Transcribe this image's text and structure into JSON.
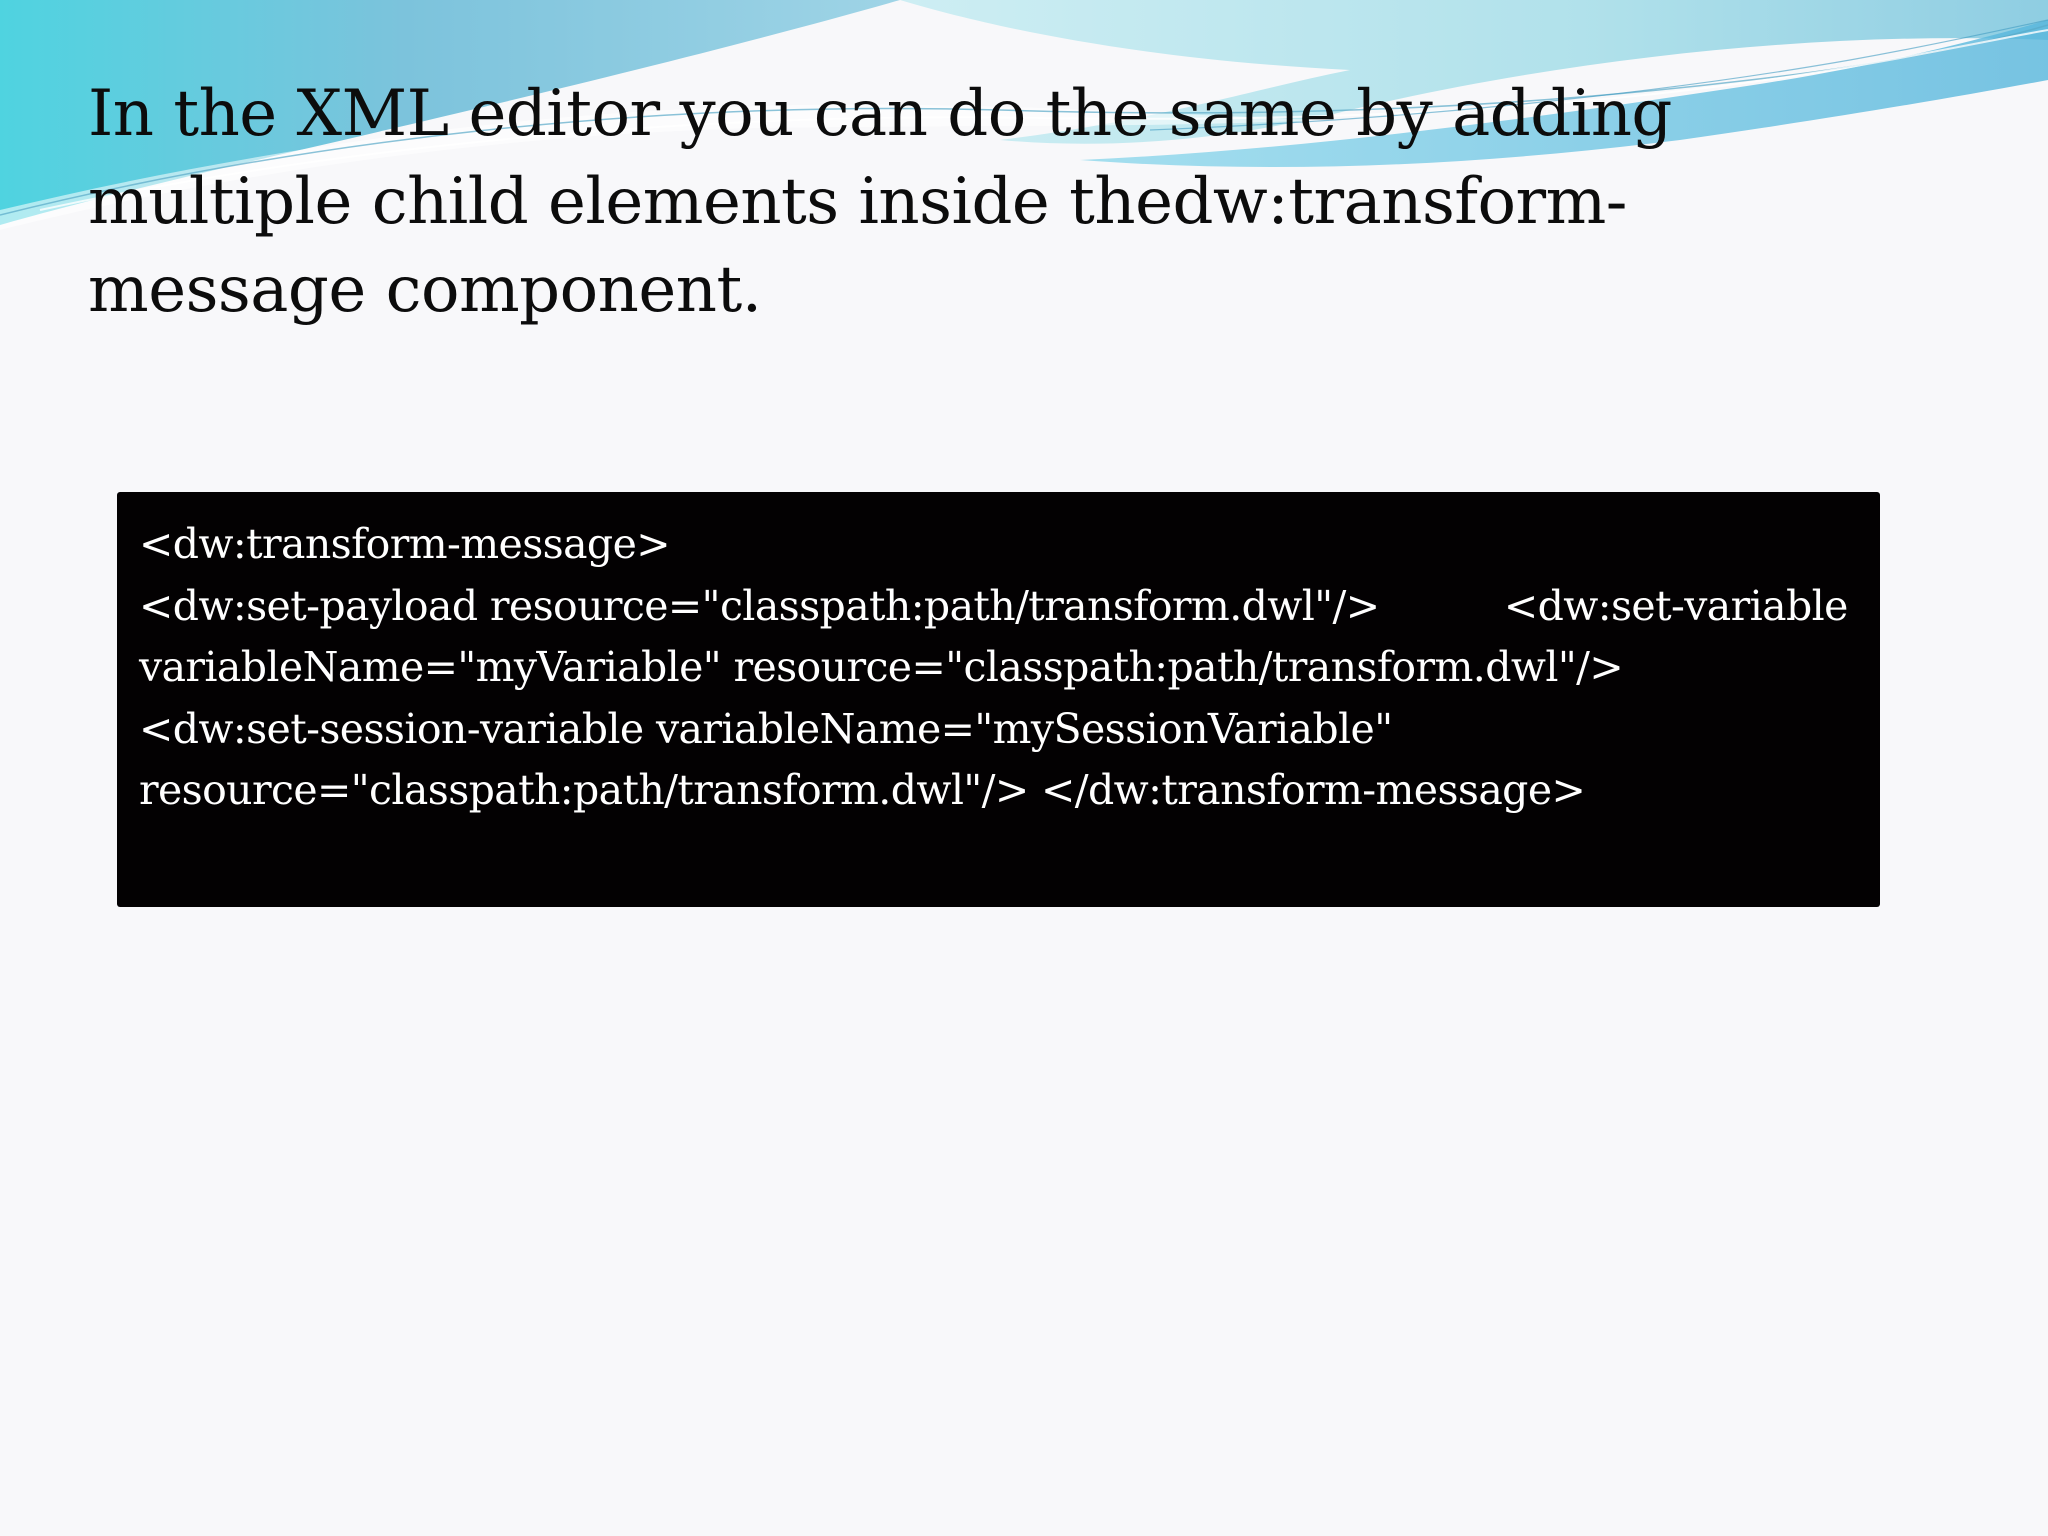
{
  "slide": {
    "title": "In the XML editor you can do the same by adding multiple child elements inside thedw:transform-message component.",
    "code": "<dw:transform-message>\n<dw:set-payload resource=\"classpath:path/transform.dwl\"/>          <dw:set-variable variableName=\"myVariable\" resource=\"classpath:path/transform.dwl\"/>          <dw:set-session-variable variableName=\"mySessionVariable\" resource=\"classpath:path/transform.dwl\"/> </dw:transform-message>"
  },
  "theme": {
    "background": "#f8f8fa",
    "code_background": "#030102",
    "code_text_color": "#ffffff",
    "title_color": "#0c0c0c",
    "wave_colors": [
      "#6fd0df",
      "#8ec9de",
      "#b9e3ec",
      "#5fb8d6"
    ]
  }
}
